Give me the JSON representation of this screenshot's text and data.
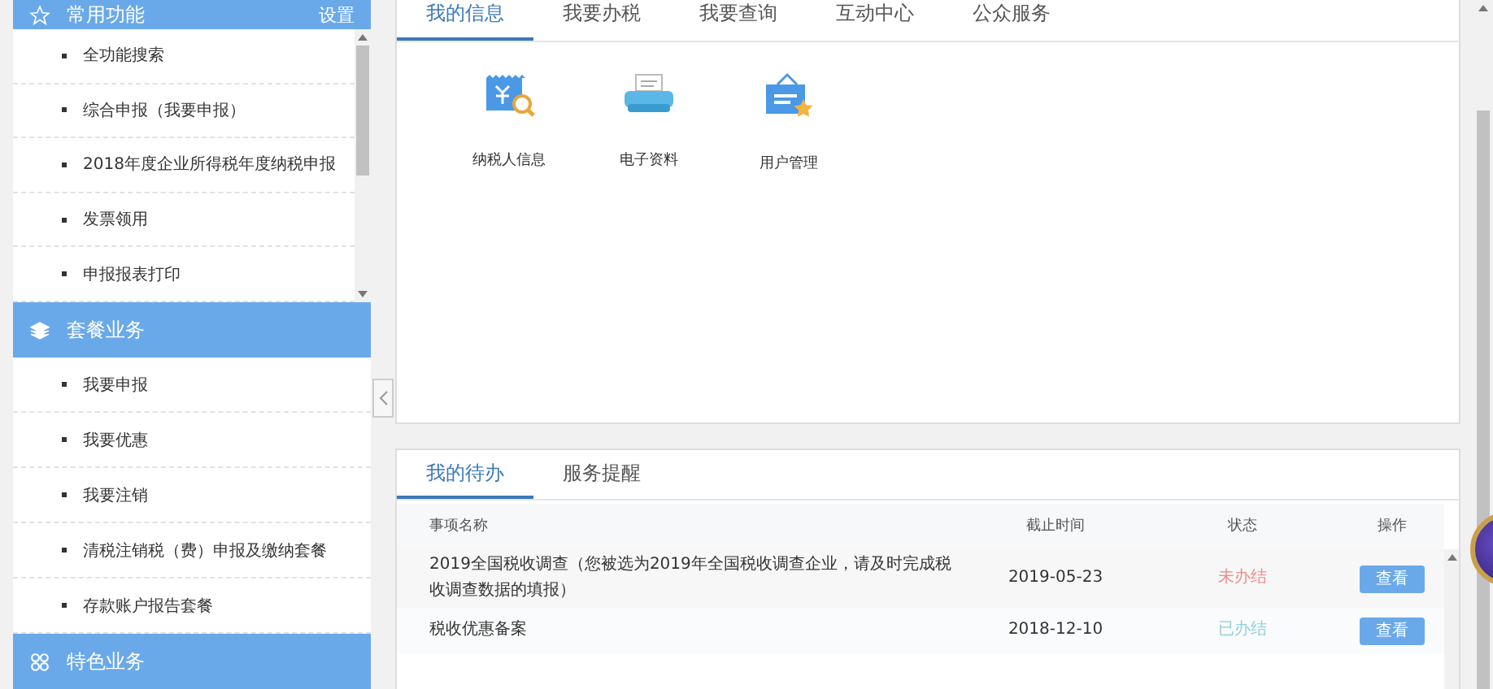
{
  "sidebar": {
    "groups": [
      {
        "title": "常用功能",
        "kind": "favorites",
        "action": "设置",
        "items": [
          "全功能搜索",
          "综合申报（我要申报）",
          "2018年度企业所得税年度纳税申报",
          "发票领用",
          "申报报表打印"
        ]
      },
      {
        "title": "套餐业务",
        "kind": "packages",
        "items": [
          "我要申报",
          "我要优惠",
          "我要注销",
          "清税注销税（费）申报及缴纳套餐",
          "存款账户报告套餐"
        ]
      },
      {
        "title": "特色业务",
        "kind": "featured"
      }
    ]
  },
  "top_tabs": [
    {
      "label": "我的信息",
      "selected": true
    },
    {
      "label": "我要办税",
      "selected": false
    },
    {
      "label": "我要查询",
      "selected": false
    },
    {
      "label": "互动中心",
      "selected": false
    },
    {
      "label": "公众服务",
      "selected": false
    }
  ],
  "shortcuts": [
    {
      "kind": "taxpayer",
      "label": "纳税人信息"
    },
    {
      "kind": "documents",
      "label": "电子资料"
    },
    {
      "kind": "users",
      "label": "用户管理"
    }
  ],
  "todo_tabs": [
    {
      "label": "我的待办",
      "selected": true
    },
    {
      "label": "服务提醒",
      "selected": false
    }
  ],
  "table": {
    "columns": [
      "事项名称",
      "截止时间",
      "状态",
      "操作"
    ],
    "rows": [
      {
        "name": "2019全国税收调查（您被选为2019年全国税收调查企业，请及时完成税收调查数据的填报）",
        "deadline": "2019-05-23",
        "status": "未办结",
        "done": false,
        "action": "查看"
      },
      {
        "name": "税收优惠备案",
        "deadline": "2018-12-10",
        "status": "已办结",
        "done": true,
        "action": "查看"
      }
    ]
  }
}
